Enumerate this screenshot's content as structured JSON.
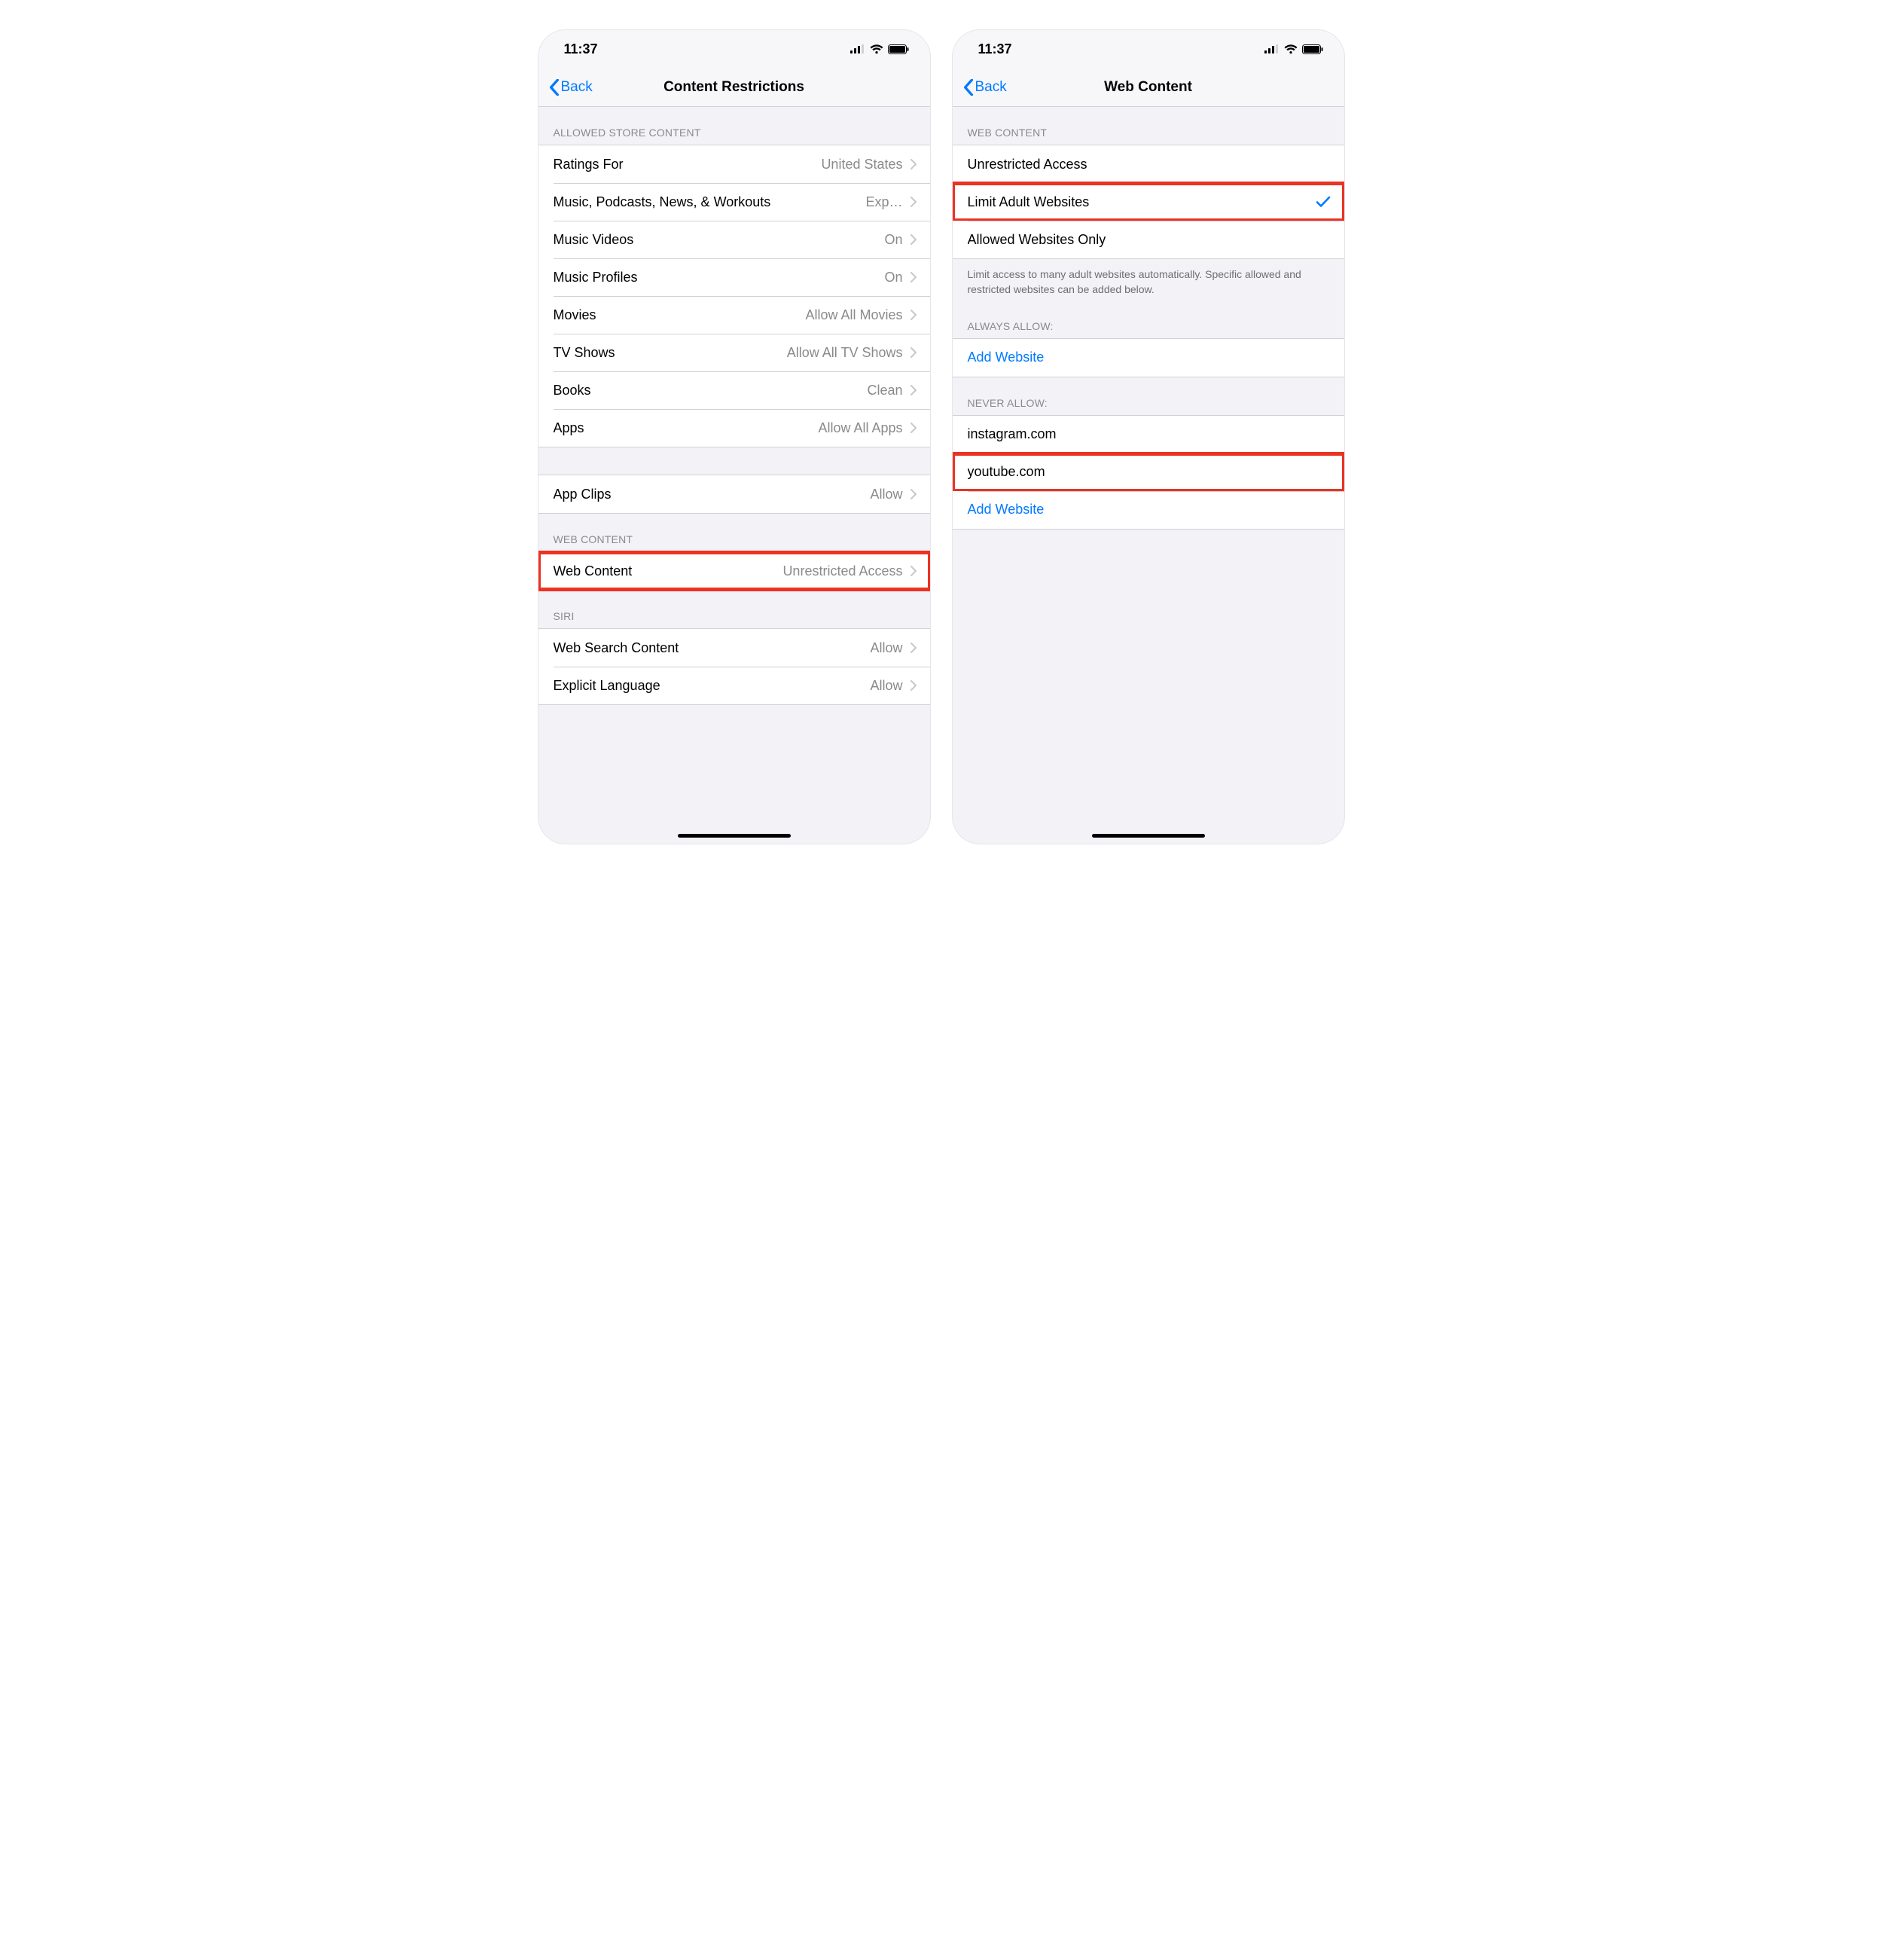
{
  "status": {
    "time": "11:37"
  },
  "left": {
    "back": "Back",
    "title": "Content Restrictions",
    "sections": {
      "allowed_store": {
        "header": "ALLOWED STORE CONTENT",
        "rows": [
          {
            "label": "Ratings For",
            "value": "United States"
          },
          {
            "label": "Music, Podcasts, News, & Workouts",
            "value": "Exp…"
          },
          {
            "label": "Music Videos",
            "value": "On"
          },
          {
            "label": "Music Profiles",
            "value": "On"
          },
          {
            "label": "Movies",
            "value": "Allow All Movies"
          },
          {
            "label": "TV Shows",
            "value": "Allow All TV Shows"
          },
          {
            "label": "Books",
            "value": "Clean"
          },
          {
            "label": "Apps",
            "value": "Allow All Apps"
          }
        ]
      },
      "app_clips": {
        "rows": [
          {
            "label": "App Clips",
            "value": "Allow"
          }
        ]
      },
      "web_content": {
        "header": "WEB CONTENT",
        "rows": [
          {
            "label": "Web Content",
            "value": "Unrestricted Access"
          }
        ]
      },
      "siri": {
        "header": "SIRI",
        "rows": [
          {
            "label": "Web Search Content",
            "value": "Allow"
          },
          {
            "label": "Explicit Language",
            "value": "Allow"
          }
        ]
      }
    }
  },
  "right": {
    "back": "Back",
    "title": "Web Content",
    "sections": {
      "web_content": {
        "header": "WEB CONTENT",
        "options": [
          {
            "label": "Unrestricted Access",
            "selected": false
          },
          {
            "label": "Limit Adult Websites",
            "selected": true
          },
          {
            "label": "Allowed Websites Only",
            "selected": false
          }
        ],
        "footer": "Limit access to many adult websites automatically. Specific allowed and restricted websites can be added below."
      },
      "always_allow": {
        "header": "ALWAYS ALLOW:",
        "add": "Add Website"
      },
      "never_allow": {
        "header": "NEVER ALLOW:",
        "items": [
          "instagram.com",
          "youtube.com"
        ],
        "add": "Add Website"
      }
    }
  }
}
